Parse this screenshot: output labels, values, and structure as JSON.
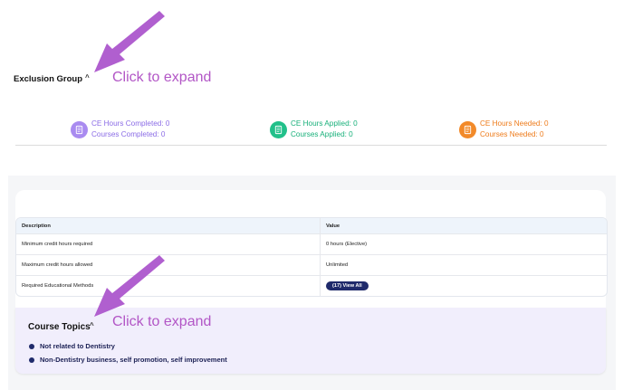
{
  "exclusion_group": {
    "title": "Exclusion Group",
    "chevron": "^"
  },
  "annotations": {
    "click_to_expand_1": "Click to expand",
    "click_to_expand_2": "Click to expand"
  },
  "stats": [
    {
      "line1": "CE Hours Completed: 0",
      "line2": "Courses Completed: 0",
      "icon": "document-icon",
      "color": "#a98bf0"
    },
    {
      "line1": "CE Hours Applied: 0",
      "line2": "Courses Applied: 0",
      "icon": "document-icon",
      "color": "#22c08a"
    },
    {
      "line1": "CE Hours Needed: 0",
      "line2": "Courses Needed: 0",
      "icon": "document-icon",
      "color": "#f28a2a"
    }
  ],
  "table": {
    "headers": [
      "Description",
      "Value"
    ],
    "rows": [
      [
        "Minimum credit hours required",
        "0 hours (Elective)"
      ],
      [
        "Maximum credit hours allowed",
        "Unlimited"
      ],
      [
        "Required Educational Methods",
        ""
      ]
    ],
    "view_all_label": "(17) View All"
  },
  "course_topics": {
    "title": "Course Topics",
    "chevron": "^",
    "items": [
      "Not related to Dentistry",
      "Non-Dentistry business, self promotion, self improvement"
    ]
  },
  "colors": {
    "annotation": "#b256c6",
    "arrow": "#b05fcf",
    "navy": "#1f2a6b"
  }
}
